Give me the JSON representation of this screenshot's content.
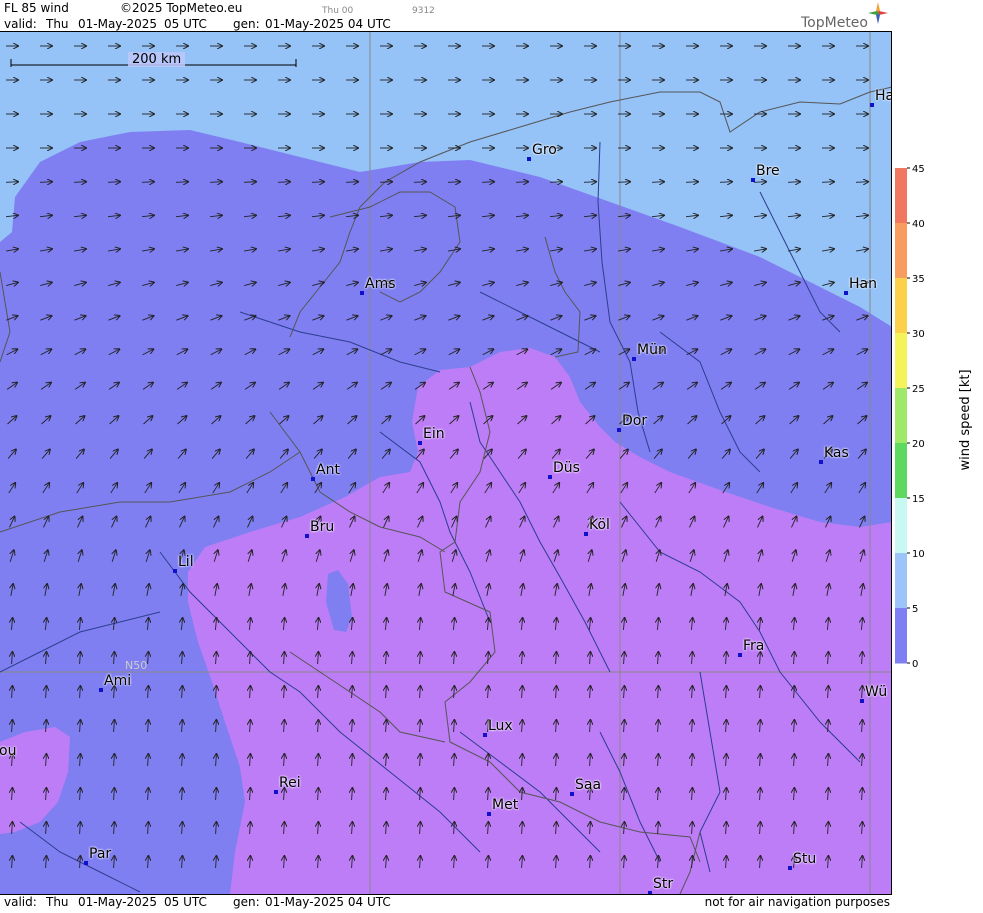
{
  "header": {
    "product": "FL 85 wind",
    "copyright": "©2025 TopMeteo.eu",
    "time_tag": "Thu 00",
    "code_tag": "9312",
    "valid_label": "valid:",
    "valid_day": "Thu",
    "valid_date": "01-May-2025",
    "valid_time": "05 UTC",
    "gen_label": "gen:",
    "gen_value": "01-May-2025 04 UTC",
    "brand": "TopMeteo"
  },
  "footer": {
    "valid_label": "valid:",
    "valid_day": "Thu",
    "valid_date": "01-May-2025",
    "valid_time": "05 UTC",
    "gen_label": "gen:",
    "gen_value": "01-May-2025 04 UTC",
    "disclaimer": "not for air navigation purposes"
  },
  "map": {
    "scale_label": "200 km",
    "lat_label": "N50",
    "cities": [
      {
        "name": "Ha"
      },
      {
        "name": "Gro"
      },
      {
        "name": "Bre"
      },
      {
        "name": "Ams"
      },
      {
        "name": "Han"
      },
      {
        "name": "Mün"
      },
      {
        "name": "Ein"
      },
      {
        "name": "Dor"
      },
      {
        "name": "Ant"
      },
      {
        "name": "Düs"
      },
      {
        "name": "Kas"
      },
      {
        "name": "Bru"
      },
      {
        "name": "Köl"
      },
      {
        "name": "Lil"
      },
      {
        "name": "Fra"
      },
      {
        "name": "Ami"
      },
      {
        "name": "Wü"
      },
      {
        "name": "Lux"
      },
      {
        "name": "ou"
      },
      {
        "name": "Rei"
      },
      {
        "name": "Saa"
      },
      {
        "name": "Met"
      },
      {
        "name": "Par"
      },
      {
        "name": "Stu"
      },
      {
        "name": "Str"
      }
    ]
  },
  "legend": {
    "title": "wind speed [kt]",
    "ticks": [
      "45",
      "40",
      "35",
      "30",
      "25",
      "20",
      "15",
      "10",
      "5",
      "0"
    ],
    "colors": [
      "#f07860",
      "#f89c60",
      "#fbd04a",
      "#f4f45a",
      "#9ee86a",
      "#5fd85f",
      "#c9f7f2",
      "#9cc4f8",
      "#7f7ff4",
      "#b87cf5"
    ]
  },
  "colors": {
    "band_light": "#95c2f7",
    "band_mid": "#7f7ff2",
    "band_purple": "#bd7df6",
    "border": "#606060",
    "river": "#2c3e8e",
    "city_dot": "#1111cc"
  }
}
